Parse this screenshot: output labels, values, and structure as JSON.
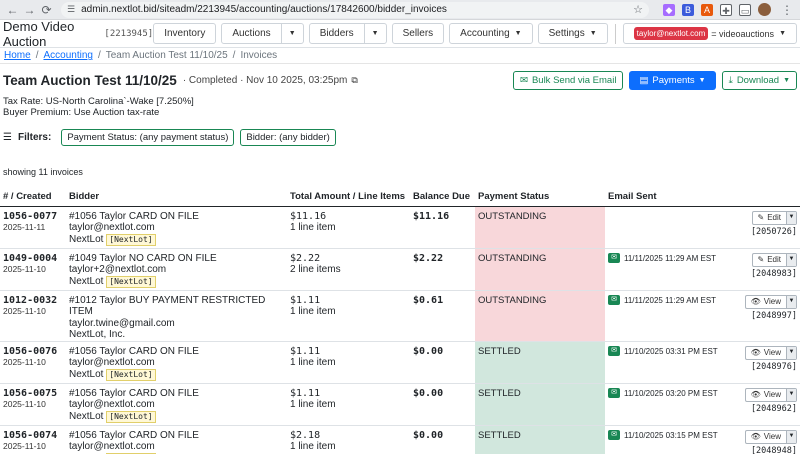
{
  "browser": {
    "url": "admin.nextlot.bid/siteadm/2213945/accounting/auctions/17842600/bidder_invoices"
  },
  "navbar": {
    "brand": "Demo Video Auction",
    "site_id": "[2213945]",
    "inventory": "Inventory",
    "auctions": "Auctions",
    "bidders": "Bidders",
    "sellers": "Sellers",
    "accounting": "Accounting",
    "settings": "Settings",
    "user_email": "taylor@nextlot.com",
    "account": "= videoauctions"
  },
  "breadcrumb": {
    "home": "Home",
    "accounting": "Accounting",
    "auction": "Team Auction Test 11/10/25",
    "current": "Invoices"
  },
  "header": {
    "title": "Team Auction Test 11/10/25",
    "subtitle": "· Completed · Nov 10 2025, 03:25pm",
    "bulk_send": "Bulk Send via Email",
    "payments": "Payments",
    "download": "Download"
  },
  "info": {
    "tax_rate": "Tax Rate: US-North Carolina`-Wake [7.250%]",
    "buyer_premium": "Buyer Premium: Use Auction tax-rate"
  },
  "filters": {
    "label": "Filters:",
    "payment_status": "Payment Status: (any payment status)",
    "bidder": "Bidder: (any bidder)"
  },
  "showing": "showing 11 invoices",
  "table": {
    "headers": {
      "created": "# / Created",
      "bidder": "Bidder",
      "total": "Total Amount / Line Items",
      "balance": "Balance Due",
      "status": "Payment Status",
      "email": "Email Sent"
    },
    "rows": [
      {
        "num": "1056-0077",
        "date": "2025-11-11",
        "bidder": "#1056 Taylor CARD ON FILE",
        "email": "taylor@nextlot.com",
        "company": "NextLot",
        "tag": "[NextLot]",
        "total": "$11.16",
        "items": "1 line item",
        "balance": "$11.16",
        "status": "OUTSTANDING",
        "sent": "",
        "action": "Edit",
        "ref": "[2050726]"
      },
      {
        "num": "1049-0004",
        "date": "2025-11-10",
        "bidder": "#1049 Taylor NO CARD ON FILE",
        "email": "taylor+2@nextlot.com",
        "company": "NextLot",
        "tag": "[NextLot]",
        "total": "$2.22",
        "items": "2 line items",
        "balance": "$2.22",
        "status": "OUTSTANDING",
        "sent": "11/11/2025 11:29 AM EST",
        "action": "Edit",
        "ref": "[2048983]"
      },
      {
        "num": "1012-0032",
        "date": "2025-11-10",
        "bidder": "#1012 Taylor BUY PAYMENT RESTRICTED ITEM",
        "email": "taylor.twine@gmail.com",
        "company": "NextLot, Inc.",
        "tag": "",
        "total": "$1.11",
        "items": "1 line item",
        "balance": "$0.61",
        "status": "OUTSTANDING",
        "sent": "11/11/2025 11:29 AM EST",
        "action": "View",
        "ref": "[2048997]"
      },
      {
        "num": "1056-0076",
        "date": "2025-11-10",
        "bidder": "#1056 Taylor CARD ON FILE",
        "email": "taylor@nextlot.com",
        "company": "NextLot",
        "tag": "[NextLot]",
        "total": "$1.11",
        "items": "1 line item",
        "balance": "$0.00",
        "status": "SETTLED",
        "sent": "11/10/2025 03:31 PM EST",
        "action": "View",
        "ref": "[2048976]"
      },
      {
        "num": "1056-0075",
        "date": "2025-11-10",
        "bidder": "#1056 Taylor CARD ON FILE",
        "email": "taylor@nextlot.com",
        "company": "NextLot",
        "tag": "[NextLot]",
        "total": "$1.11",
        "items": "1 line item",
        "balance": "$0.00",
        "status": "SETTLED",
        "sent": "11/10/2025 03:20 PM EST",
        "action": "View",
        "ref": "[2048962]"
      },
      {
        "num": "1056-0074",
        "date": "2025-11-10",
        "bidder": "#1056 Taylor CARD ON FILE",
        "email": "taylor@nextlot.com",
        "company": "NextLot",
        "tag": "[NextLot]",
        "total": "$2.18",
        "items": "1 line item",
        "balance": "$0.00",
        "status": "SETTLED",
        "sent": "11/10/2025 03:15 PM EST",
        "action": "View",
        "ref": "[2048948]"
      }
    ]
  }
}
